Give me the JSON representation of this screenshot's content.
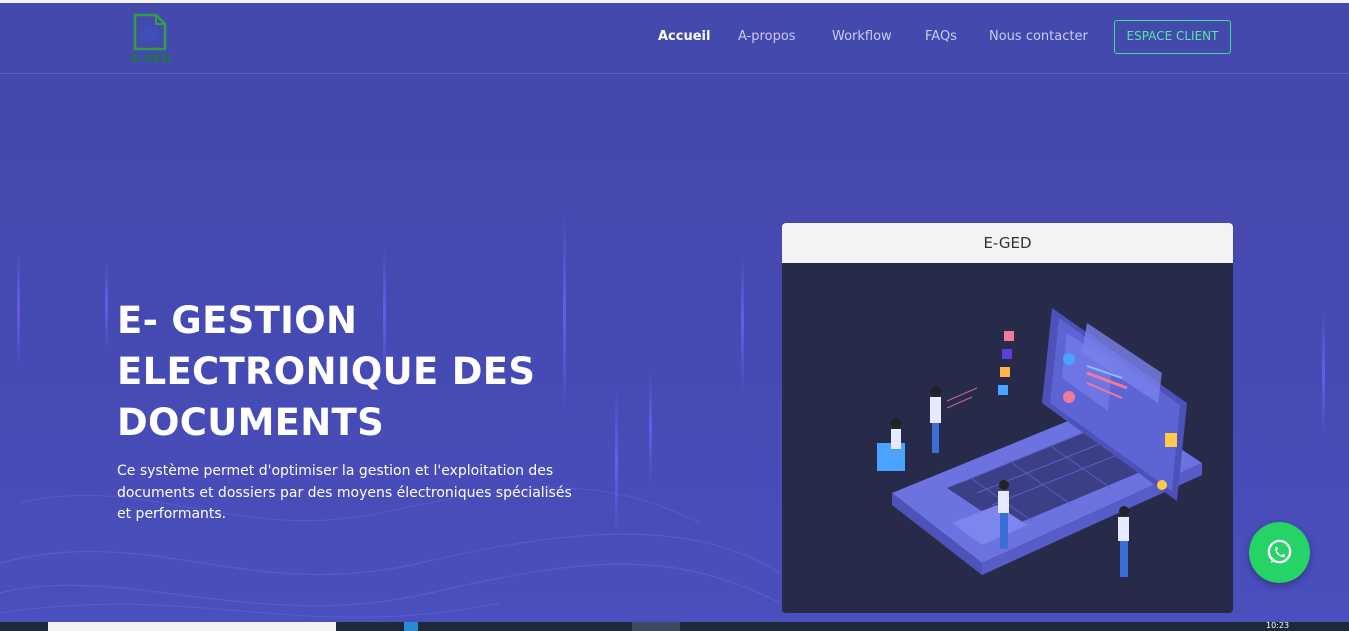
{
  "brand": {
    "logo_text": "E-GED"
  },
  "nav": {
    "items": [
      {
        "label": "Accueil",
        "active": true
      },
      {
        "label": "A-propos",
        "active": false
      },
      {
        "label": "Workflow",
        "active": false
      },
      {
        "label": "FAQs",
        "active": false
      },
      {
        "label": "Nous contacter",
        "active": false
      }
    ],
    "cta_label": "ESPACE CLIENT"
  },
  "hero": {
    "title_lines": [
      "E- GESTION",
      "ELECTRONIQUE DES",
      "DOCUMENTS"
    ],
    "description": "Ce système permet d'optimiser la gestion et l'exploitation des documents et dossiers par des moyens électroniques spécialisés et performants."
  },
  "card": {
    "header": "E-GED",
    "image_icon": "isometric-laptop-illustration"
  },
  "floating": {
    "icon": "whatsapp-icon"
  },
  "taskbar": {
    "clock": "10:23"
  },
  "colors": {
    "background": "#4449ad",
    "accent_green": "#3ddf8e",
    "whatsapp": "#25d366",
    "card_dark": "#262a47"
  }
}
